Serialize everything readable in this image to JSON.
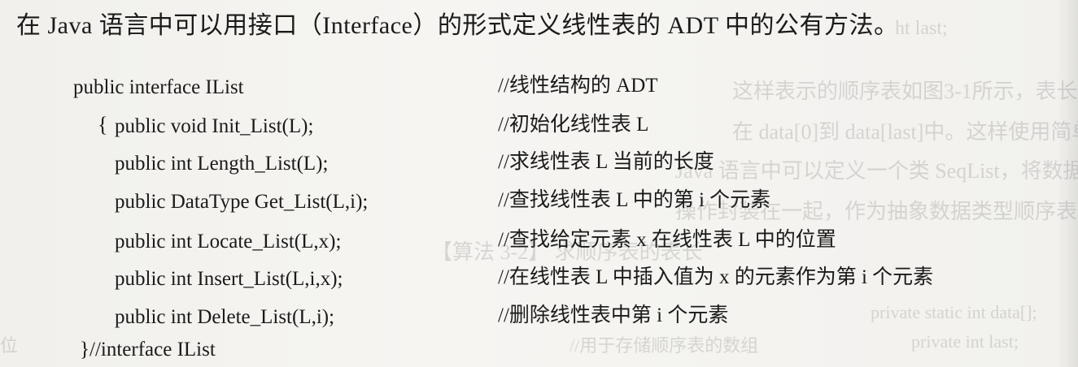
{
  "heading": "在 Java 语言中可以用接口（Interface）的形式定义线性表的 ADT 中的公有方法。",
  "code": [
    {
      "code": "public interface IList",
      "comment": "//线性结构的 ADT"
    },
    {
      "code": "public void Init_List(L);",
      "comment": "//初始化线性表 L"
    },
    {
      "code": "public int Length_List(L);",
      "comment": "//求线性表 L 当前的长度"
    },
    {
      "code": "public DataType Get_List(L,i);",
      "comment": "//查找线性表 L 中的第 i 个元素"
    },
    {
      "code": "public int Locate_List(L,x);",
      "comment": "//查找给定元素 x 在线性表 L 中的位置"
    },
    {
      "code": "public int Insert_List(L,i,x);",
      "comment": "//在线性表 L 中插入值为 x 的元素作为第 i 个元素"
    },
    {
      "code": "public int Delete_List(L,i);",
      "comment": "//删除线性表中第 i 个元素"
    },
    {
      "code": "}//interface IList",
      "comment": ""
    }
  ],
  "braces": {
    "open": "{"
  }
}
